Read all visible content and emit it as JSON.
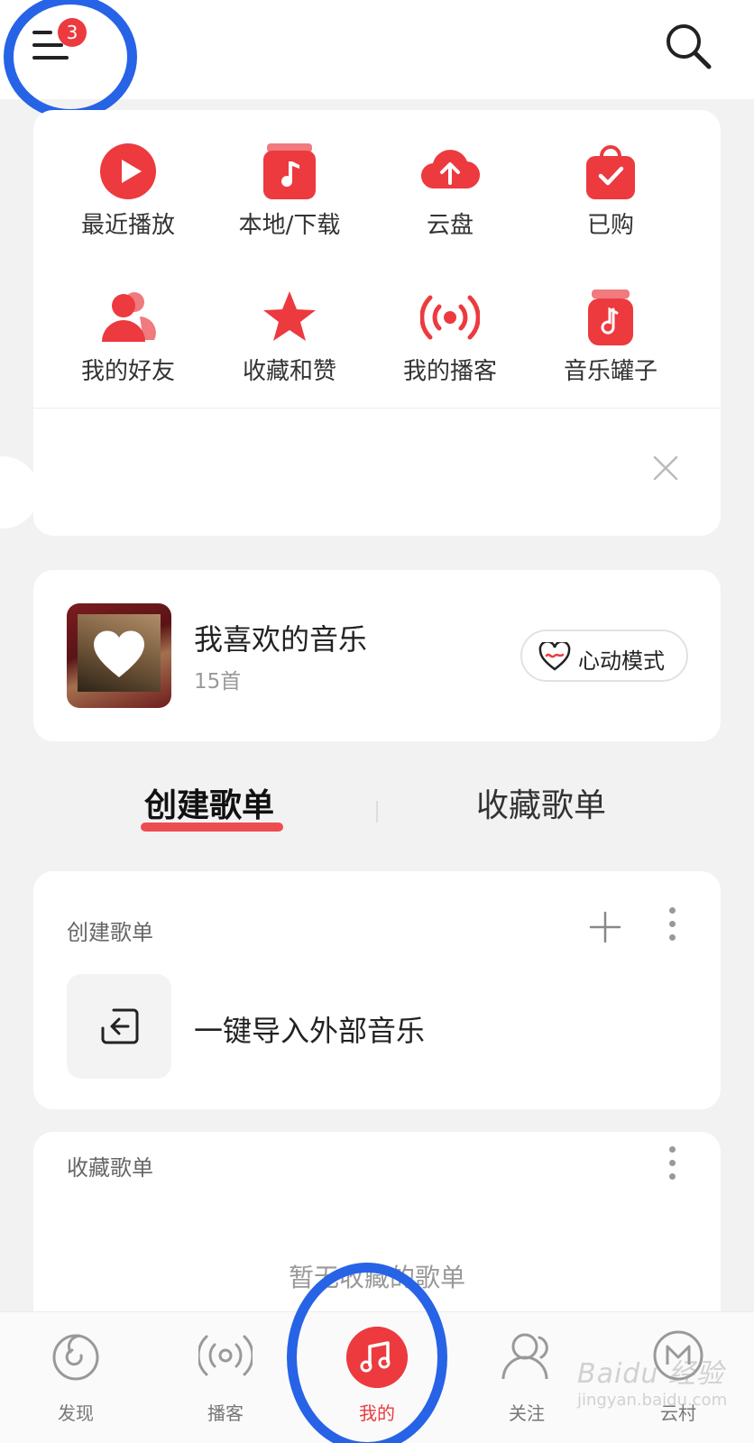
{
  "header": {
    "menu_badge": "3"
  },
  "grid": {
    "items": [
      {
        "label": "最近播放",
        "icon": "play-circle-icon"
      },
      {
        "label": "本地/下载",
        "icon": "music-folder-icon"
      },
      {
        "label": "云盘",
        "icon": "cloud-upload-icon"
      },
      {
        "label": "已购",
        "icon": "shopping-bag-check-icon"
      },
      {
        "label": "我的好友",
        "icon": "friends-icon"
      },
      {
        "label": "收藏和赞",
        "icon": "star-icon"
      },
      {
        "label": "我的播客",
        "icon": "broadcast-icon"
      },
      {
        "label": "音乐罐子",
        "icon": "music-jar-icon"
      }
    ]
  },
  "favorites": {
    "title": "我喜欢的音乐",
    "count": "15首",
    "mode_button": "心动模式"
  },
  "tabs": {
    "created": "创建歌单",
    "collected": "收藏歌单"
  },
  "created_section": {
    "title": "创建歌单",
    "import_label": "一键导入外部音乐"
  },
  "collected_section": {
    "title": "收藏歌单",
    "empty_text": "暂无收藏的歌单"
  },
  "bottom_nav": {
    "items": [
      {
        "label": "发现",
        "icon": "discover-icon"
      },
      {
        "label": "播客",
        "icon": "podcast-icon"
      },
      {
        "label": "我的",
        "icon": "music-note-icon",
        "active": true
      },
      {
        "label": "关注",
        "icon": "follow-user-icon"
      },
      {
        "label": "云村",
        "icon": "cloud-village-icon"
      }
    ]
  },
  "watermark": {
    "brand": "Baidu 经验",
    "url": "jingyan.baidu.com"
  },
  "colors": {
    "accent": "#ec3a3f",
    "highlight_ring": "#2763e6",
    "background": "#f2f2f2"
  }
}
